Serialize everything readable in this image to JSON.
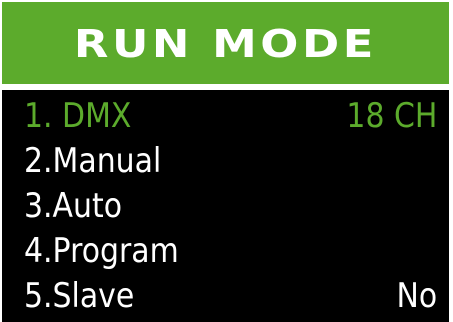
{
  "header": {
    "title": "RUN MODE"
  },
  "menu": {
    "items": [
      {
        "label": "1. DMX",
        "value": "18 CH",
        "selected": true
      },
      {
        "label": "2.Manual",
        "value": "",
        "selected": false
      },
      {
        "label": "3.Auto",
        "value": "",
        "selected": false
      },
      {
        "label": "4.Program",
        "value": "",
        "selected": false
      },
      {
        "label": "5.Slave",
        "value": "No",
        "selected": false
      }
    ]
  },
  "colors": {
    "accent": "#5cab2c",
    "background": "#000000",
    "text": "#ffffff"
  }
}
